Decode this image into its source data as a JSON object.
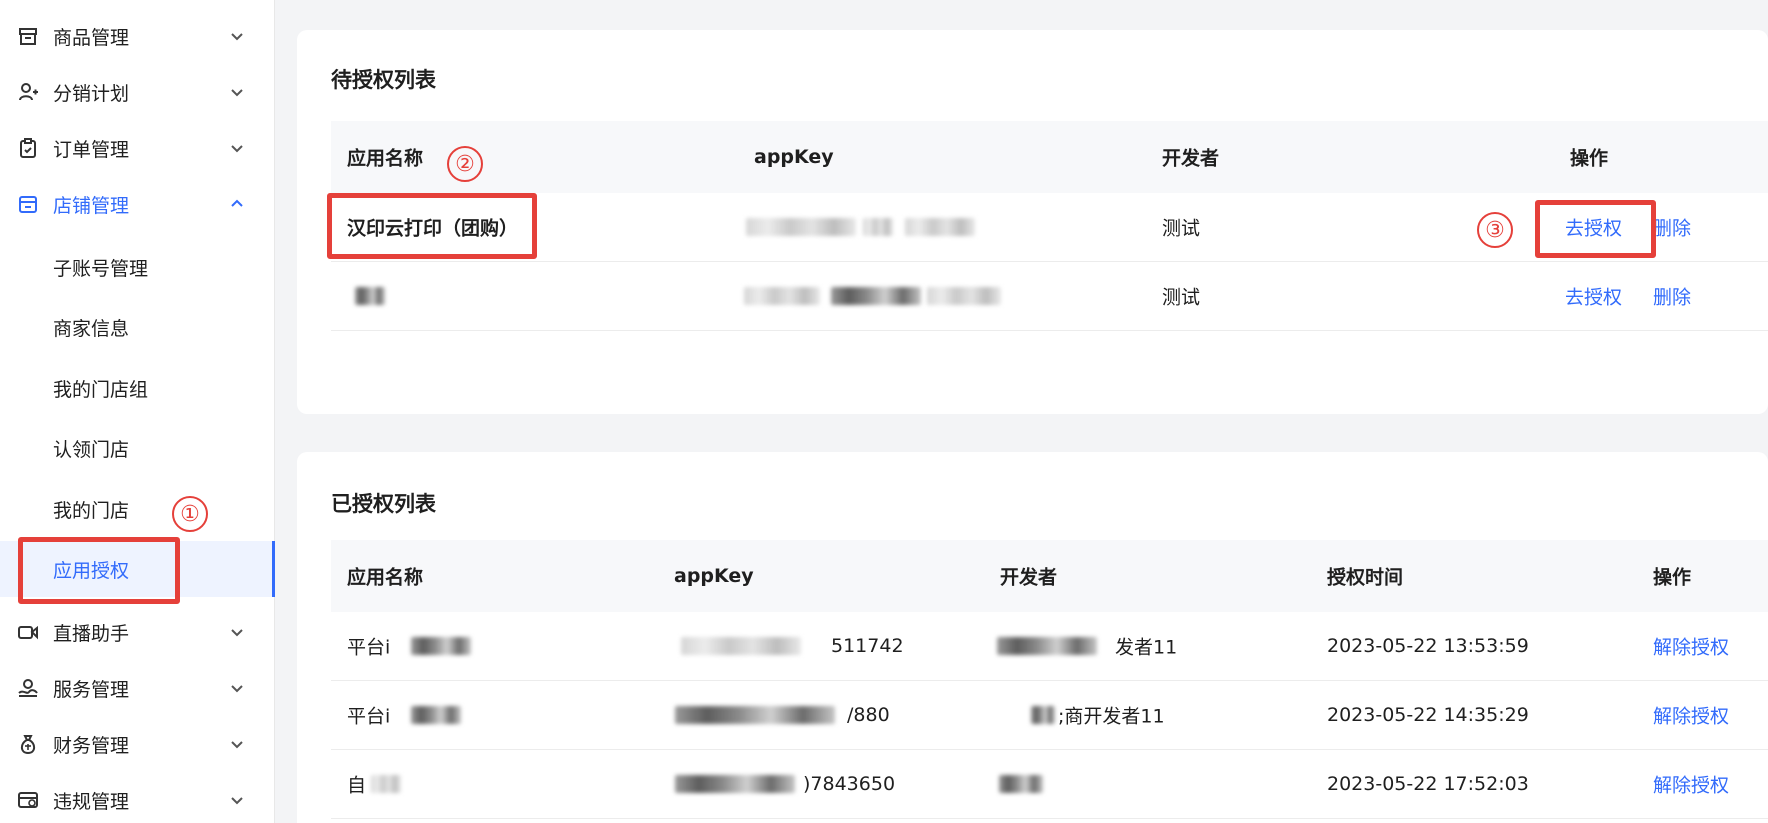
{
  "sidebar": {
    "groups": [
      {
        "label": "商品管理",
        "icon": "box-icon"
      },
      {
        "label": "分销计划",
        "icon": "user-share-icon"
      },
      {
        "label": "订单管理",
        "icon": "clipboard-icon"
      },
      {
        "label": "店铺管理",
        "icon": "store-icon"
      }
    ],
    "store_sub_items": [
      "子账号管理",
      "商家信息",
      "我的门店组",
      "认领门店",
      "我的门店",
      "应用授权"
    ],
    "lower_groups": [
      {
        "label": "直播助手",
        "icon": "video-icon"
      },
      {
        "label": "服务管理",
        "icon": "service-icon"
      },
      {
        "label": "财务管理",
        "icon": "money-bag-icon"
      },
      {
        "label": "违规管理",
        "icon": "violation-icon"
      }
    ]
  },
  "pending": {
    "title": "待授权列表",
    "columns": [
      "应用名称",
      "appKey",
      "开发者",
      "操作"
    ],
    "rows": [
      {
        "app_name": "汉印云打印（团购）",
        "developer": "测试",
        "action_authorize": "去授权",
        "action_delete": "删除"
      },
      {
        "app_name": "",
        "developer": "测试",
        "action_authorize": "去授权",
        "action_delete": "删除"
      }
    ]
  },
  "authorized": {
    "title": "已授权列表",
    "columns": [
      "应用名称",
      "appKey",
      "开发者",
      "授权时间",
      "操作"
    ],
    "rows": [
      {
        "app_name": "平台i",
        "app_key": "511742",
        "developer": "发者11",
        "time": "2023-05-22 13:53:59",
        "action": "解除授权"
      },
      {
        "app_name": "平台i",
        "app_key": "/880",
        "developer": ";商开发者11",
        "time": "2023-05-22 14:35:29",
        "action": "解除授权"
      },
      {
        "app_name": "自",
        "app_key": ")7843650",
        "developer": "",
        "time": "2023-05-22 17:52:03",
        "action": "解除授权"
      }
    ]
  },
  "annotations": {
    "step1": "①",
    "step2": "②",
    "step3": "③"
  },
  "colors": {
    "accent": "#326bfb",
    "highlight": "#e5403a"
  }
}
